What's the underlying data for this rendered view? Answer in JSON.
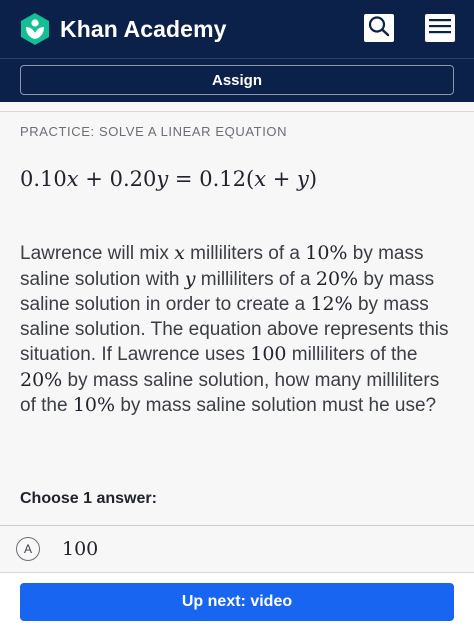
{
  "header": {
    "brand": "Khan Academy",
    "logo_icon": "khan-academy-leaf-icon",
    "search_icon": "search-icon",
    "menu_icon": "hamburger-menu-icon",
    "colors": {
      "nav_background": "#0b2149",
      "logo_green": "#14bf96",
      "primary_button": "#1865f2"
    }
  },
  "assign": {
    "label": "Assign"
  },
  "exercise": {
    "practice_label": "PRACTICE: SOLVE A LINEAR EQUATION",
    "equation": {
      "c1": "0.10",
      "v1": "x",
      "op1": "+",
      "c2": "0.20",
      "v2": "y",
      "eq": "=",
      "c3": "0.12",
      "lp": "(",
      "v3": "x",
      "op2": "+",
      "v4": "y",
      "rp": ")"
    },
    "problem": {
      "t1": "Lawrence will mix ",
      "m1": "x",
      "t2": " milliliters of a ",
      "m2": "10%",
      "t3": " by mass saline solution with ",
      "m3": "y",
      "t4": " milliliters of a ",
      "m4": "20%",
      "t5": " by mass saline solution in order to create a ",
      "m5": "12%",
      "t6": " by mass saline solution. The equation above represents this situation. If Lawrence uses ",
      "m6": "100",
      "t7": " milliliters of the ",
      "m7": "20%",
      "t8": " by mass saline solution, how many milliliters of the ",
      "m8": "10%",
      "t9": " by mass saline solution must he use?"
    },
    "choose_label": "Choose 1 answer:",
    "choices": [
      {
        "letter": "A",
        "value": "100"
      }
    ]
  },
  "footer": {
    "up_next_label": "Up next: video"
  }
}
